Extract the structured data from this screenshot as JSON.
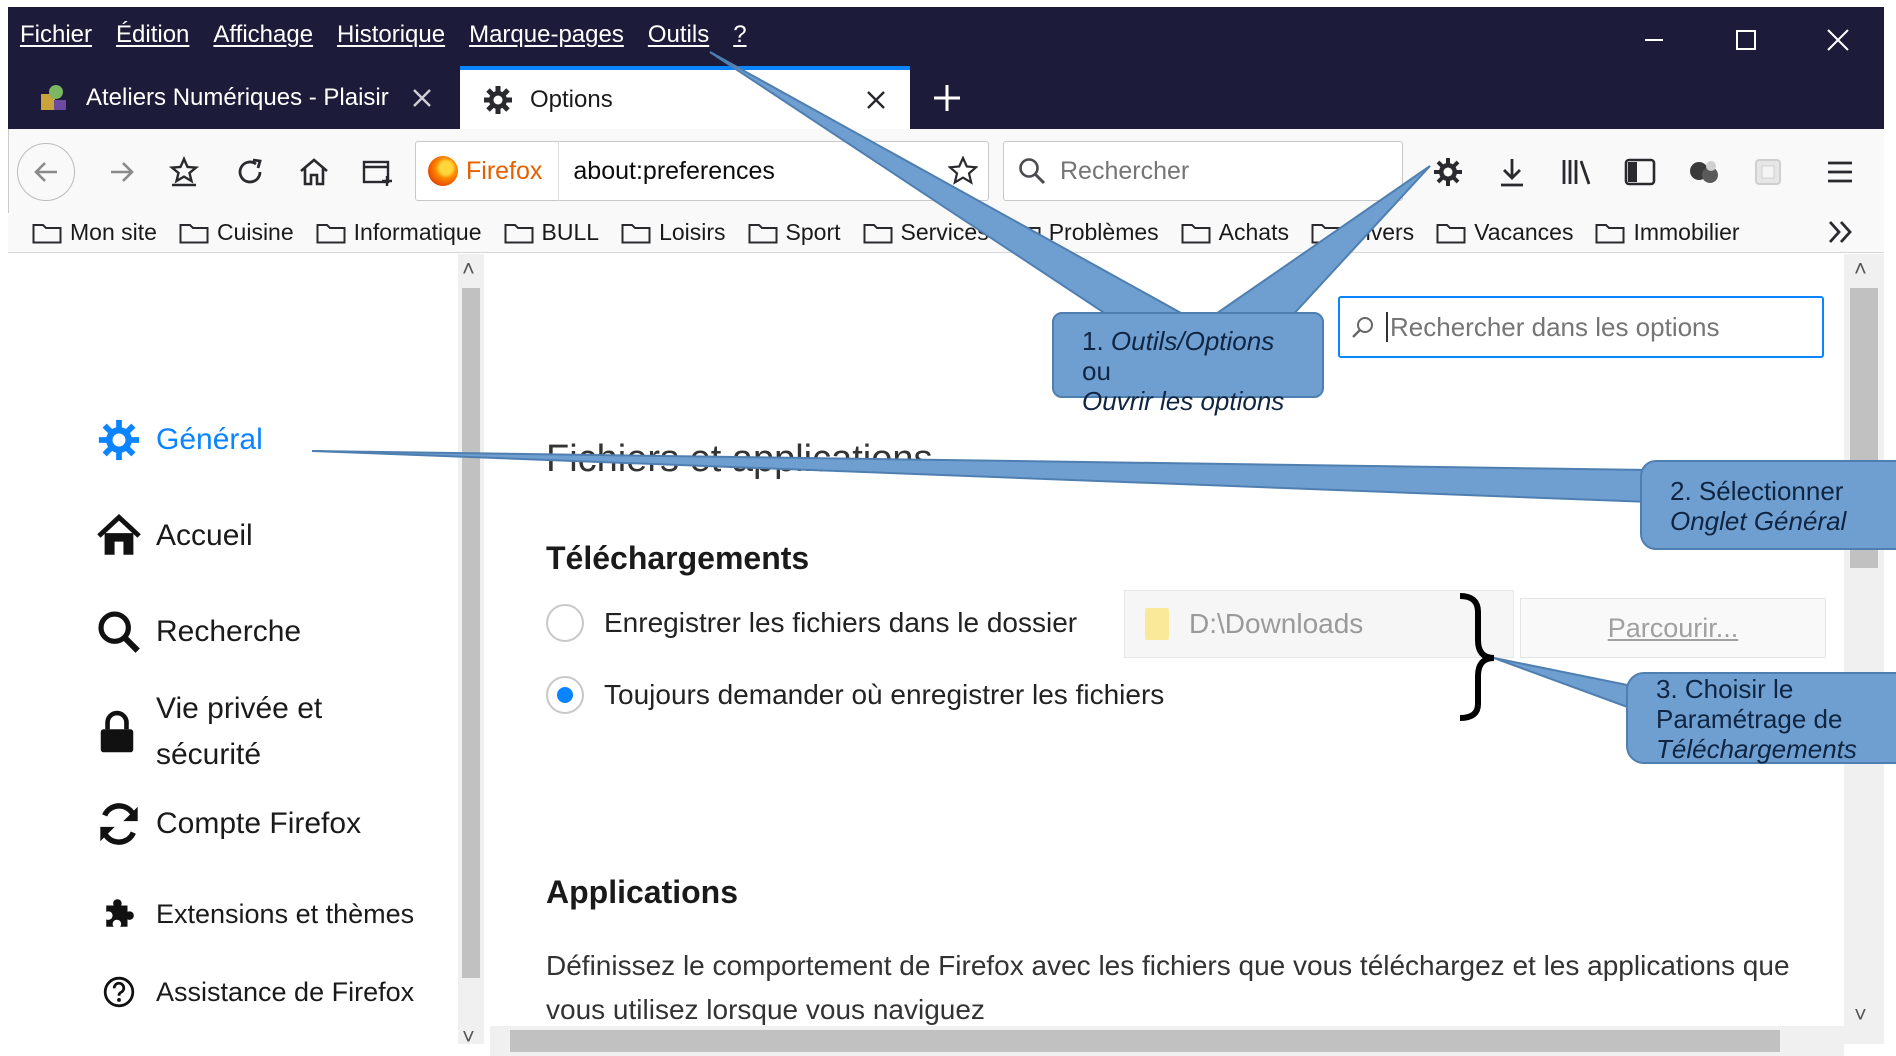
{
  "menubar": {
    "items": [
      "Fichier",
      "Édition",
      "Affichage",
      "Historique",
      "Marque-pages",
      "Outils",
      "?"
    ]
  },
  "tabs": [
    {
      "title": "Ateliers Numériques - Plaisir",
      "icon": "site-favicon",
      "active": false
    },
    {
      "title": "Options",
      "icon": "gear-icon",
      "active": true
    }
  ],
  "toolbar": {
    "identity_label": "Firefox",
    "url": "about:preferences",
    "search_placeholder": "Rechercher"
  },
  "bookmarks": [
    "Mon site",
    "Cuisine",
    "Informatique",
    "BULL",
    "Loisirs",
    "Sport",
    "Services",
    "Problèmes",
    "Achats",
    "Divers",
    "Vacances",
    "Immobilier"
  ],
  "sidebar": {
    "items": [
      {
        "label": "Général",
        "icon": "gear-icon",
        "selected": true
      },
      {
        "label": "Accueil",
        "icon": "home-icon",
        "selected": false
      },
      {
        "label": "Recherche",
        "icon": "search-icon",
        "selected": false
      },
      {
        "label_line1": "Vie privée et",
        "label_line2": "sécurité",
        "icon": "lock-icon",
        "selected": false
      },
      {
        "label": "Compte Firefox",
        "icon": "sync-icon",
        "selected": false
      },
      {
        "label": "Extensions et thèmes",
        "icon": "puzzle-icon",
        "selected": false
      },
      {
        "label": "Assistance de Firefox",
        "icon": "help-icon",
        "selected": false
      }
    ]
  },
  "main": {
    "pref_search_placeholder": "Rechercher dans les options",
    "section_title": "Fichiers et applications",
    "downloads_heading": "Téléchargements",
    "radio_save_label": "Enregistrer les fichiers dans le dossier",
    "radio_ask_label": "Toujours demander où enregistrer les fichiers",
    "download_folder": "D:\\Downloads",
    "browse_button": "Parcourir...",
    "applications_heading": "Applications",
    "applications_text": "Définissez le comportement de Firefox avec les fichiers que vous téléchargez et les applications que vous utilisez lorsque vous naviguez"
  },
  "callouts": {
    "c1_prefix": "1. ",
    "c1_italic": "Outils/Options",
    "c1_mid": " ou",
    "c1_line2": "Ouvrir les options",
    "c2_line1": "2. Sélectionner",
    "c2_line2": "Onglet Général",
    "c3_line1": "3. Choisir le",
    "c3_line2": "Paramétrage de",
    "c3_line3": "Téléchargements"
  },
  "colors": {
    "accent": "#0a84ff",
    "titlebar": "#1c1b3a",
    "callout_fill": "#6f9fd0"
  }
}
